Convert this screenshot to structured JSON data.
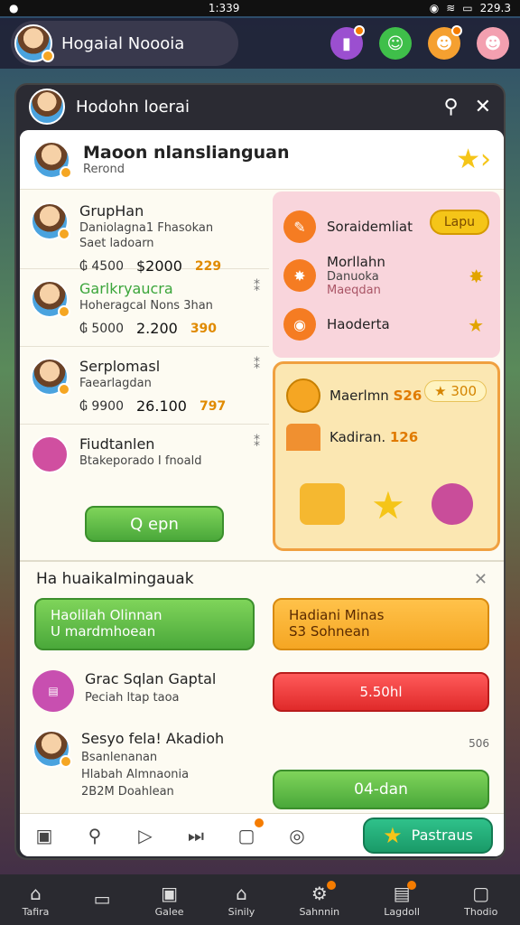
{
  "status": {
    "time": "1:339",
    "battery": "229.3"
  },
  "topbar": {
    "profile_name": "Hogaial Noooia"
  },
  "panel": {
    "title": "Hodohn loerai"
  },
  "hero": {
    "name": "Maoon nlanslianguan",
    "sub": "Rerond"
  },
  "friends": [
    {
      "name": "GrupHan",
      "sub1": "Daniolagna1 Fhasokan",
      "sub2": "Saet ladoarn",
      "v1": "₲ 4500",
      "v2": "$2000",
      "v3": "229"
    },
    {
      "name": "Garlkryaucra",
      "sub1": "Hoheragcal Nons 3han",
      "sub2": "",
      "v1": "₲ 5000",
      "v2": "2.200",
      "v3": "390"
    },
    {
      "name": "Serplomasl",
      "sub1": "Faearlagdan",
      "sub2": "",
      "v1": "₲ 9900",
      "v2": "26.100",
      "v3": "797"
    },
    {
      "name": "Fiudtanlen",
      "sub1": "Btakeporado I fnoald",
      "sub2": "",
      "v1": "",
      "v2": "",
      "v3": ""
    }
  ],
  "open_button": "Q epn",
  "pink": {
    "row1": {
      "label": "Soraidemliat",
      "tag": "Lapu"
    },
    "row2": {
      "label": "Morllahn",
      "sub1": "Danuoka",
      "sub2": "Maeqdan"
    },
    "row3": {
      "label": "Haoderta"
    }
  },
  "treasure": {
    "row1": {
      "label": "Maerlmn",
      "amount": "S26",
      "pill": "300"
    },
    "row2": {
      "label": "Kadiran.",
      "amount": "126"
    }
  },
  "section2": {
    "title": "Ha huaikaImingauak",
    "btn_green": {
      "l1": "Haolilah Olinnan",
      "l2": "U mardmhoean"
    },
    "btn_orange": {
      "l1": "Hadiani Minas",
      "l2": "S3 Sohnean"
    },
    "entry1": {
      "name": "Grac Sqlan Gaptal",
      "sub": "Peciah ltap taoa"
    },
    "btn_red": "5.50hl",
    "entry2": {
      "name": "Sesyo fela! Akadioh",
      "sub1": "Bsanlenanan",
      "sub2": "Hlabah Almnaonia",
      "sub3": "2B2M Doahlean"
    },
    "entry2_small": "506",
    "btn_green2": "04-dan"
  },
  "premium": "Pastraus",
  "nav": [
    "Tafira",
    "",
    "Galee",
    "Sinily",
    "Sahnnin",
    "Lagdoll",
    "Thodio"
  ]
}
